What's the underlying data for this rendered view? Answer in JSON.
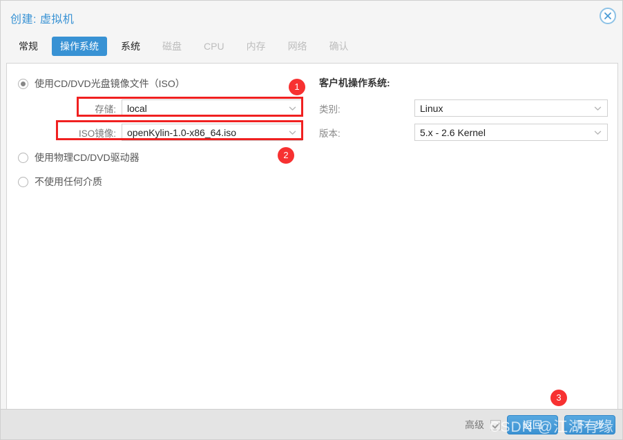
{
  "window": {
    "title": "创建: 虚拟机",
    "close_icon": "close-circle-icon"
  },
  "tabs": [
    {
      "label": "常规",
      "state": "enabled"
    },
    {
      "label": "操作系统",
      "state": "active"
    },
    {
      "label": "系统",
      "state": "enabled"
    },
    {
      "label": "磁盘",
      "state": "disabled"
    },
    {
      "label": "CPU",
      "state": "disabled"
    },
    {
      "label": "内存",
      "state": "disabled"
    },
    {
      "label": "网络",
      "state": "disabled"
    },
    {
      "label": "确认",
      "state": "disabled"
    }
  ],
  "media": {
    "options": [
      {
        "label": "使用CD/DVD光盘镜像文件（ISO）",
        "checked": true
      },
      {
        "label": "使用物理CD/DVD驱动器",
        "checked": false
      },
      {
        "label": "不使用任何介质",
        "checked": false
      }
    ],
    "storage": {
      "label": "存储:",
      "value": "local"
    },
    "iso": {
      "label": "ISO镜像:",
      "value": "openKylin-1.0-x86_64.iso"
    }
  },
  "guest_os": {
    "heading": "客户机操作系统:",
    "category": {
      "label": "类别:",
      "value": "Linux"
    },
    "version": {
      "label": "版本:",
      "value": "5.x - 2.6 Kernel"
    }
  },
  "footer": {
    "advanced_label": "高级",
    "advanced_checked": true,
    "back_button": "返回",
    "next_button": "下一步"
  },
  "annotations": {
    "badges": [
      "1",
      "2",
      "3"
    ]
  },
  "watermark": {
    "text": "CSDN @江湖有缘"
  },
  "colors": {
    "accent": "#3892d4",
    "annotation_red": "#f73131",
    "footer_bg": "#e4e4e4",
    "panel_bg": "#ffffff"
  }
}
